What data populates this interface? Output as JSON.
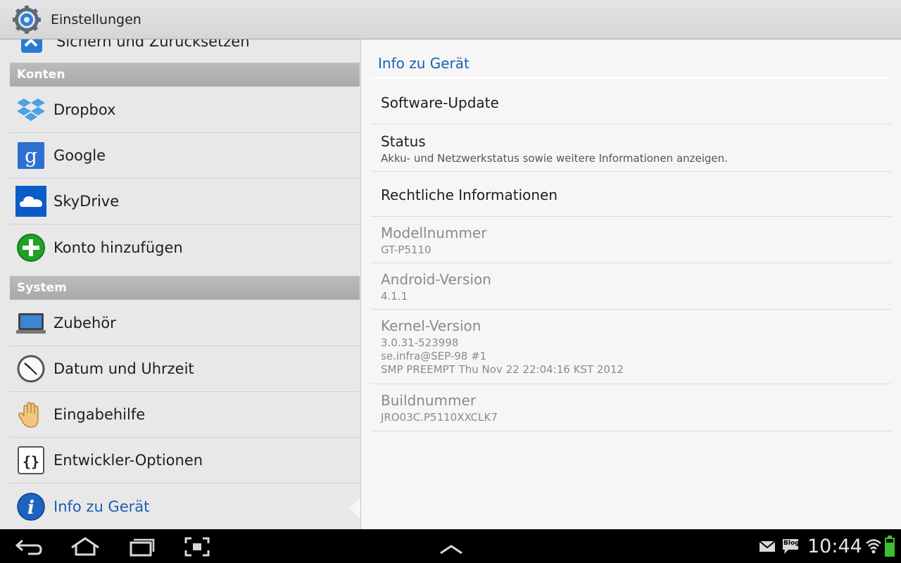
{
  "app": {
    "title": "Einstellungen",
    "icon": "settings-gear-icon"
  },
  "left": {
    "cut_item_label": "Sichern und Zurücksetzen",
    "sections": [
      {
        "key": "konten",
        "label": "Konten"
      },
      {
        "key": "system",
        "label": "System"
      }
    ],
    "accounts": [
      {
        "label": "Dropbox",
        "icon": "dropbox-icon"
      },
      {
        "label": "Google",
        "icon": "google-icon"
      },
      {
        "label": "SkyDrive",
        "icon": "skydrive-icon"
      },
      {
        "label": "Konto hinzufügen",
        "icon": "add-account-icon"
      }
    ],
    "system": [
      {
        "label": "Zubehör",
        "icon": "accessory-icon"
      },
      {
        "label": "Datum und Uhrzeit",
        "icon": "clock-icon"
      },
      {
        "label": "Eingabehilfe",
        "icon": "hand-icon"
      },
      {
        "label": "Entwickler-Optionen",
        "icon": "braces-icon"
      },
      {
        "label": "Info zu Gerät",
        "icon": "info-icon",
        "selected": true
      }
    ]
  },
  "right": {
    "header": "Info zu Gerät",
    "items": [
      {
        "title": "Software-Update",
        "summary": ""
      },
      {
        "title": "Status",
        "summary": "Akku- und Netzwerkstatus sowie weitere Informationen anzeigen."
      },
      {
        "title": "Rechtliche Informationen",
        "summary": ""
      },
      {
        "title": "Modellnummer",
        "summary": "GT-P5110"
      },
      {
        "title": "Android-Version",
        "summary": "4.1.1"
      },
      {
        "title": "Kernel-Version",
        "summary_lines": [
          "3.0.31-523998",
          "se.infra@SEP-98 #1",
          "SMP PREEMPT Thu Nov 22 22:04:16 KST 2012"
        ]
      },
      {
        "title": "Buildnummer",
        "summary": "JRO03C.P5110XXCLK7"
      }
    ]
  },
  "statusbar": {
    "time": "10:44",
    "blog_badge": "Blog",
    "icons": [
      "back-icon",
      "home-icon",
      "recent-apps-icon",
      "screenshot-icon",
      "up-arrow-icon",
      "gmail-icon",
      "blog-icon",
      "wifi-icon",
      "battery-icon"
    ],
    "battery_level": 0.8
  },
  "colors": {
    "accent": "#1c5fb0",
    "section_bg": "#ababab",
    "sysbar": "#000000"
  }
}
